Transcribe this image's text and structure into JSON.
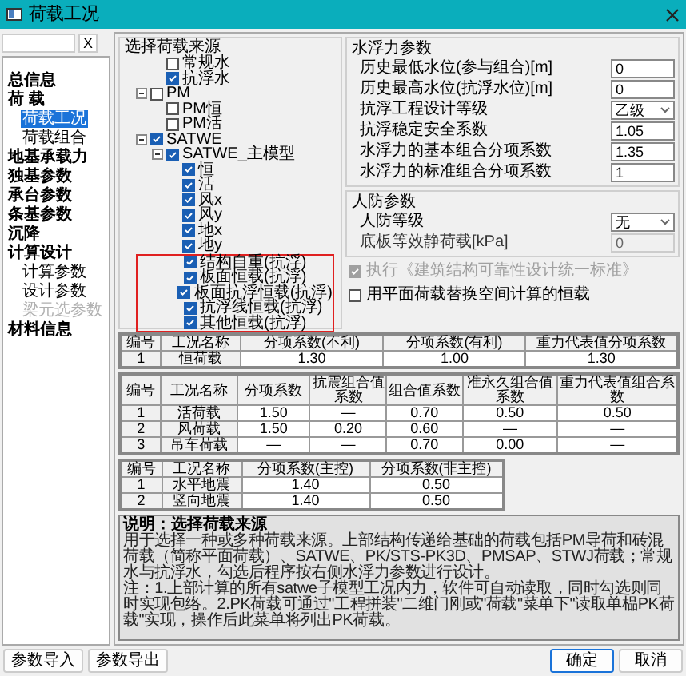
{
  "window": {
    "title": "荷载工况"
  },
  "left_panel": {
    "clear_button": "X",
    "nav": [
      {
        "label": "总信息",
        "selected": false,
        "disabled": false
      },
      {
        "label": "荷 载",
        "selected": false,
        "disabled": false,
        "children": [
          {
            "label": "荷载工况",
            "selected": true,
            "disabled": false
          },
          {
            "label": "荷载组合",
            "selected": false,
            "disabled": false
          }
        ]
      },
      {
        "label": "地基承载力",
        "selected": false,
        "disabled": false
      },
      {
        "label": "独基参数",
        "selected": false,
        "disabled": false
      },
      {
        "label": "承台参数",
        "selected": false,
        "disabled": false
      },
      {
        "label": "条基参数",
        "selected": false,
        "disabled": false
      },
      {
        "label": "沉降",
        "selected": false,
        "disabled": false
      },
      {
        "label": "计算设计",
        "selected": false,
        "disabled": false,
        "children": [
          {
            "label": "计算参数",
            "selected": false,
            "disabled": false
          },
          {
            "label": "设计参数",
            "selected": false,
            "disabled": false
          },
          {
            "label": "梁元选参数",
            "selected": false,
            "disabled": true
          }
        ]
      },
      {
        "label": "材料信息",
        "selected": false,
        "disabled": false
      }
    ],
    "buttons": [
      "参数导入",
      "参数导出"
    ]
  },
  "load_source": {
    "title": "选择荷载来源",
    "tree": [
      {
        "label": "常规水",
        "checked": false
      },
      {
        "label": "抗浮水",
        "checked": true
      },
      {
        "label": "PM",
        "checked": false,
        "expanded": true,
        "children": [
          {
            "label": "PM恒",
            "checked": false
          },
          {
            "label": "PM活",
            "checked": false
          }
        ]
      },
      {
        "label": "SATWE",
        "checked": true,
        "expanded": true,
        "children": [
          {
            "label": "SATWE_主模型",
            "checked": true,
            "expanded": true,
            "children": [
              {
                "label": "恒",
                "checked": true,
                "highlighted": false
              },
              {
                "label": "活",
                "checked": true,
                "highlighted": false
              },
              {
                "label": "风x",
                "checked": true,
                "highlighted": false
              },
              {
                "label": "风y",
                "checked": true,
                "highlighted": false
              },
              {
                "label": "地x",
                "checked": true,
                "highlighted": false
              },
              {
                "label": "地y",
                "checked": true,
                "highlighted": false
              },
              {
                "label": "结构自重(抗浮)",
                "checked": true,
                "highlighted": true
              },
              {
                "label": "板面恒载(抗浮)",
                "checked": true,
                "highlighted": true
              },
              {
                "label": "板面抗浮恒载(抗浮)",
                "checked": true,
                "highlighted": true
              },
              {
                "label": "抗浮线恒载(抗浮)",
                "checked": true,
                "highlighted": true
              },
              {
                "label": "其他恒载(抗浮)",
                "checked": true,
                "highlighted": true
              }
            ]
          }
        ]
      }
    ]
  },
  "buoyancy": {
    "title": "水浮力参数",
    "fields": [
      {
        "kind": "input",
        "label": "历史最低水位(参与组合)[m]",
        "value": "0",
        "disabled": false
      },
      {
        "kind": "input",
        "label": "历史最高水位(抗浮水位)[m]",
        "value": "0",
        "disabled": false
      },
      {
        "kind": "select",
        "label": "抗浮工程设计等级",
        "value": "乙级",
        "disabled": false
      },
      {
        "kind": "input",
        "label": "抗浮稳定安全系数",
        "value": "1.05",
        "disabled": false
      },
      {
        "kind": "input",
        "label": "水浮力的基本组合分项系数",
        "value": "1.35",
        "disabled": false
      },
      {
        "kind": "input",
        "label": "水浮力的标准组合分项系数",
        "value": "1",
        "disabled": false
      }
    ]
  },
  "civil_defense": {
    "title": "人防参数",
    "fields": [
      {
        "kind": "select",
        "label": "人防等级",
        "value": "无",
        "disabled": false
      },
      {
        "kind": "input",
        "label": "底板等效静荷载[kPa]",
        "value": "0",
        "disabled": true
      }
    ]
  },
  "options": [
    {
      "label": "执行《建筑结构可靠性设计统一标准》",
      "checked": true,
      "disabled": true
    },
    {
      "label": "用平面荷载替换空间计算的恒载",
      "checked": false,
      "disabled": false
    }
  ],
  "tables": [
    {
      "columns": [
        "编号",
        "工况名称",
        "分项系数(不利)",
        "分项系数(有利)",
        "重力代表值分项系数"
      ],
      "rows": [
        [
          "1",
          "恒荷载",
          "1.30",
          "1.00",
          "1.30"
        ]
      ]
    },
    {
      "columns": [
        "编号",
        "工况名称",
        "分项系数",
        "抗震组合值系数",
        "组合值系数",
        "准永久组合值系数",
        "重力代表值组合系数"
      ],
      "rows": [
        [
          "1",
          "活荷载",
          "1.50",
          "—",
          "0.70",
          "0.50",
          "0.50"
        ],
        [
          "2",
          "风荷载",
          "1.50",
          "0.20",
          "0.60",
          "—",
          "—"
        ],
        [
          "3",
          "吊车荷载",
          "—",
          "—",
          "0.70",
          "0.00",
          "—"
        ]
      ]
    },
    {
      "columns": [
        "编号",
        "工况名称",
        "分项系数(主控)",
        "分项系数(非主控)"
      ],
      "rows": [
        [
          "1",
          "水平地震",
          "1.40",
          "0.50"
        ],
        [
          "2",
          "竖向地震",
          "1.40",
          "0.50"
        ]
      ]
    }
  ],
  "description": {
    "title": "说明：选择荷载来源",
    "paragraphs": [
      "用于选择一种或多种荷载来源。上部结构传递给基础的荷载包括PM导荷和砖混荷载（简称平面荷载）、SATWE、PK/STS-PK3D、PMSAP、STWJ荷载；常规水与抗浮水，勾选后程序按右侧水浮力参数进行设计。",
      "注：1.上部计算的所有satwe子模型工况内力，软件可自动读取，同时勾选则同时实现包络。2.PK荷载可通过\"工程拼装\"二维门刚或\"荷载\"菜单下\"读取单榀PK荷载\"实现，操作后此菜单将列出PK荷载。"
    ]
  },
  "buttons": [
    "确定",
    "取消"
  ]
}
